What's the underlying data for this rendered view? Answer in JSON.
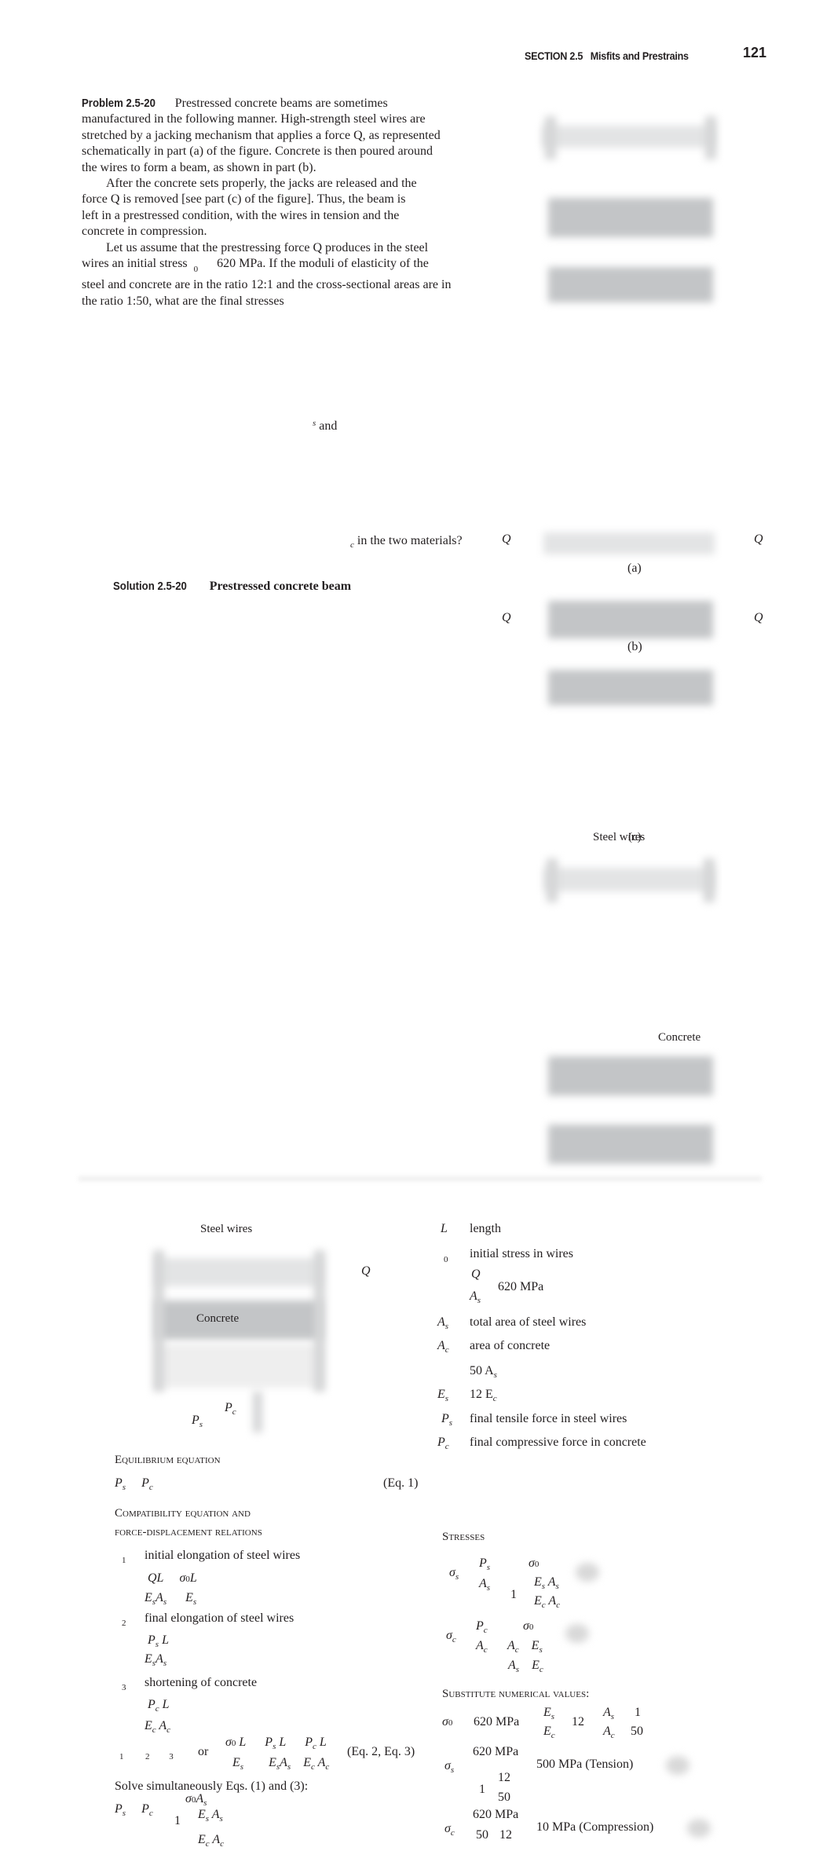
{
  "header": {
    "section": "SECTION 2.5",
    "title": "Misfits and Prestrains",
    "page_number": "121"
  },
  "problem": {
    "label": "Problem 2.5-20",
    "lines": [
      "Prestressed concrete beams are sometimes",
      "manufactured in the following manner. High-strength steel wires are",
      "stretched by a jacking mechanism that applies a force Q, as represented",
      "schematically in part (a) of the figure. Concrete is then poured around",
      "the wires to form a beam, as shown in part (b).",
      "After the concrete sets properly, the jacks are released and the",
      "force Q is removed [see part (c) of the figure]. Thus, the beam is",
      "left in a prestressed condition, with the wires in tension and the",
      "concrete in compression.",
      "Let us assume that the prestressing force Q produces in the steel",
      "wires an initial stress",
      "620 MPa. If the moduli of elasticity of the",
      "steel and concrete are in the ratio 12:1 and the cross-sectional areas are in",
      "the ratio 1:50, what are the final stresses"
    ],
    "sub0": "0",
    "frag_s": "s",
    "frag_and": "and",
    "frag_c": "c",
    "frag_end": "in the two materials?"
  },
  "figure": {
    "Q": "Q",
    "a": "(a)",
    "b": "(b)",
    "c": "(c)",
    "steel_wires": "Steel wires",
    "concrete": "Concrete"
  },
  "solution": {
    "title": "Solution 2.5-20",
    "subtitle": "Prestressed concrete beam",
    "fig": {
      "steel_wires": "Steel wires",
      "concrete": "Concrete",
      "Q": "Q",
      "P": "P",
      "s": "s",
      "c": "c"
    },
    "defs": [
      {
        "sym": "L",
        "sub": "",
        "text": "length"
      },
      {
        "sym": "",
        "sub": "0",
        "text": "initial stress in wires"
      },
      {
        "sym": "A",
        "sub": "s",
        "text": "total area of steel wires"
      },
      {
        "sym": "A",
        "sub": "c",
        "text": "area of concrete"
      },
      {
        "sym": "E",
        "sub": "s",
        "text": "12 E",
        "text_sub": "c"
      },
      {
        "sym": "P",
        "sub": "s",
        "text": "final tensile force in steel wires"
      },
      {
        "sym": "P",
        "sub": "c",
        "text": "final compressive force in concrete"
      }
    ],
    "def_q_num": "Q",
    "def_q_den": "A",
    "def_q_den_sub": "s",
    "def_q_val": "620 MPa",
    "def_ac_val": "50 A",
    "def_ac_sub": "s",
    "equilibrium": {
      "heading": "Equilibrium equation",
      "eq_tag": "(Eq. 1)"
    },
    "compat": {
      "heading1": "Compatibility equation and",
      "heading2": "force-displacement relations",
      "d1": "1",
      "d1_text": "initial elongation of steel wires",
      "d2": "2",
      "d2_text": "final elongation of steel wires",
      "d3": "3",
      "d3_text": "shortening of concrete",
      "or": "or",
      "eq_tag": "(Eq. 2, Eq. 3)"
    },
    "solve_text": "Solve simultaneously Eqs. (1) and (3):",
    "stresses_heading": "Stresses",
    "substitute_heading": "Substitute numerical values:",
    "sub_vals": {
      "sigma0": "620 MPa",
      "ratio_E": "12",
      "ratio_A_num": "1",
      "ratio_A_den": "50"
    },
    "sigma_s_result": "500 MPa (Tension)",
    "sigma_c_result": "10 MPa (Compression)",
    "num_620": "620 MPa",
    "one": "1",
    "twelve": "12",
    "fifty": "50"
  }
}
